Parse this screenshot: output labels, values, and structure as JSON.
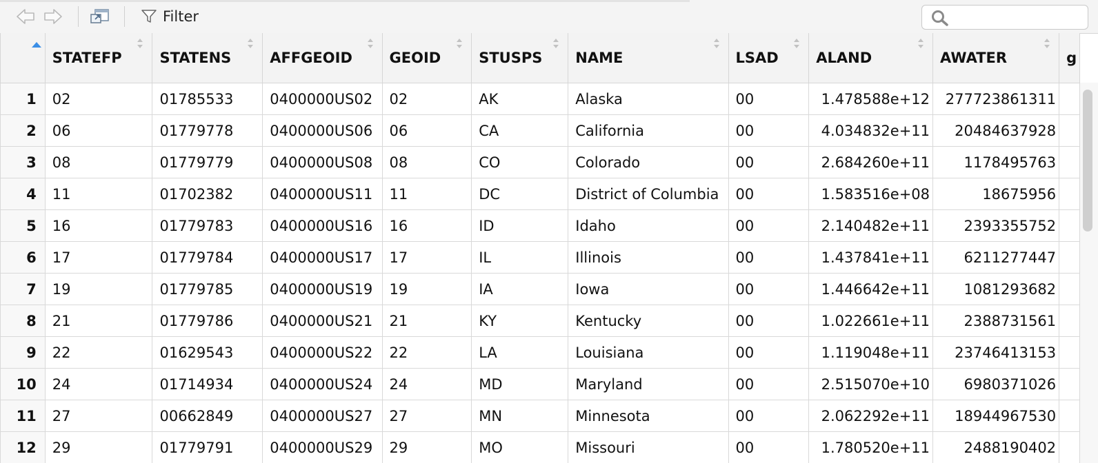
{
  "toolbar": {
    "filter_label": "Filter",
    "search": {
      "placeholder": "",
      "value": ""
    }
  },
  "columns": [
    "STATEFP",
    "STATENS",
    "AFFGEOID",
    "GEOID",
    "STUSPS",
    "NAME",
    "LSAD",
    "ALAND",
    "AWATER",
    "g"
  ],
  "rows": [
    {
      "n": "1",
      "statefp": "02",
      "statens": "01785533",
      "affgeoid": "0400000US02",
      "geoid": "02",
      "stusps": "AK",
      "name": "Alaska",
      "lsad": "00",
      "aland": "1.478588e+12",
      "awater": "277723861311"
    },
    {
      "n": "2",
      "statefp": "06",
      "statens": "01779778",
      "affgeoid": "0400000US06",
      "geoid": "06",
      "stusps": "CA",
      "name": "California",
      "lsad": "00",
      "aland": "4.034832e+11",
      "awater": "20484637928"
    },
    {
      "n": "3",
      "statefp": "08",
      "statens": "01779779",
      "affgeoid": "0400000US08",
      "geoid": "08",
      "stusps": "CO",
      "name": "Colorado",
      "lsad": "00",
      "aland": "2.684260e+11",
      "awater": "1178495763"
    },
    {
      "n": "4",
      "statefp": "11",
      "statens": "01702382",
      "affgeoid": "0400000US11",
      "geoid": "11",
      "stusps": "DC",
      "name": "District of Columbia",
      "lsad": "00",
      "aland": "1.583516e+08",
      "awater": "18675956"
    },
    {
      "n": "5",
      "statefp": "16",
      "statens": "01779783",
      "affgeoid": "0400000US16",
      "geoid": "16",
      "stusps": "ID",
      "name": "Idaho",
      "lsad": "00",
      "aland": "2.140482e+11",
      "awater": "2393355752"
    },
    {
      "n": "6",
      "statefp": "17",
      "statens": "01779784",
      "affgeoid": "0400000US17",
      "geoid": "17",
      "stusps": "IL",
      "name": "Illinois",
      "lsad": "00",
      "aland": "1.437841e+11",
      "awater": "6211277447"
    },
    {
      "n": "7",
      "statefp": "19",
      "statens": "01779785",
      "affgeoid": "0400000US19",
      "geoid": "19",
      "stusps": "IA",
      "name": "Iowa",
      "lsad": "00",
      "aland": "1.446642e+11",
      "awater": "1081293682"
    },
    {
      "n": "8",
      "statefp": "21",
      "statens": "01779786",
      "affgeoid": "0400000US21",
      "geoid": "21",
      "stusps": "KY",
      "name": "Kentucky",
      "lsad": "00",
      "aland": "1.022661e+11",
      "awater": "2388731561"
    },
    {
      "n": "9",
      "statefp": "22",
      "statens": "01629543",
      "affgeoid": "0400000US22",
      "geoid": "22",
      "stusps": "LA",
      "name": "Louisiana",
      "lsad": "00",
      "aland": "1.119048e+11",
      "awater": "23746413153"
    },
    {
      "n": "10",
      "statefp": "24",
      "statens": "01714934",
      "affgeoid": "0400000US24",
      "geoid": "24",
      "stusps": "MD",
      "name": "Maryland",
      "lsad": "00",
      "aland": "2.515070e+10",
      "awater": "6980371026"
    },
    {
      "n": "11",
      "statefp": "27",
      "statens": "00662849",
      "affgeoid": "0400000US27",
      "geoid": "27",
      "stusps": "MN",
      "name": "Minnesota",
      "lsad": "00",
      "aland": "2.062292e+11",
      "awater": "18944967530"
    },
    {
      "n": "12",
      "statefp": "29",
      "statens": "01779791",
      "affgeoid": "0400000US29",
      "geoid": "29",
      "stusps": "MO",
      "name": "Missouri",
      "lsad": "00",
      "aland": "1.780520e+11",
      "awater": "2488190402"
    }
  ]
}
